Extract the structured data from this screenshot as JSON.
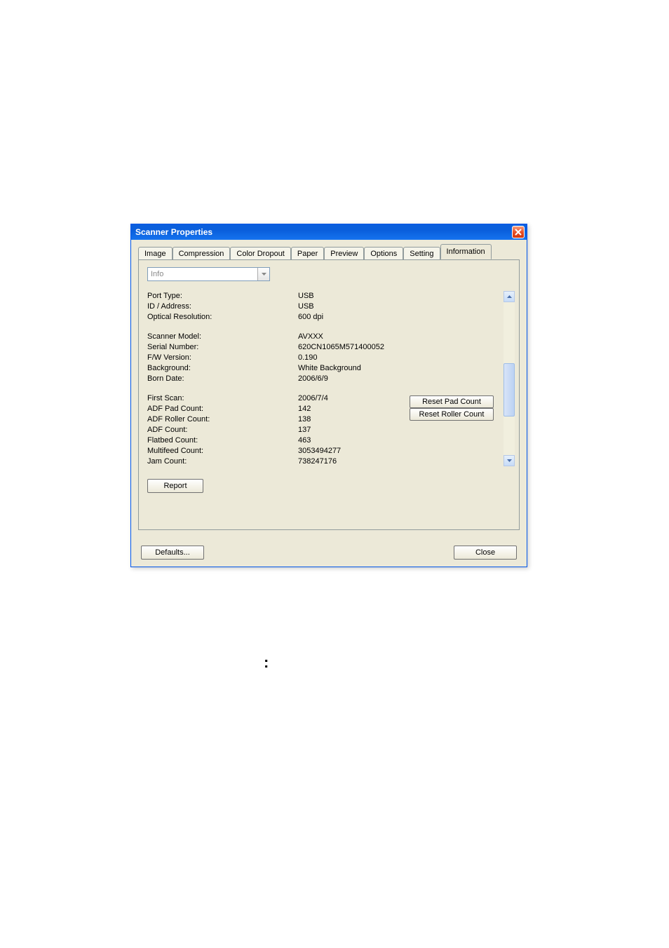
{
  "window": {
    "title": "Scanner Properties"
  },
  "tabs": {
    "image": "Image",
    "compression": "Compression",
    "color_dropout": "Color Dropout",
    "paper": "Paper",
    "preview": "Preview",
    "options": "Options",
    "setting": "Setting",
    "information": "Information"
  },
  "info_dropdown": {
    "value": "Info"
  },
  "fields": {
    "port_type": {
      "label": "Port Type:",
      "value": "USB"
    },
    "id_address": {
      "label": "ID / Address:",
      "value": "USB"
    },
    "optical_res": {
      "label": "Optical Resolution:",
      "value": "600 dpi"
    },
    "scanner_model": {
      "label": "Scanner Model:",
      "value": "AVXXX"
    },
    "serial_number": {
      "label": "Serial Number:",
      "value": "620CN1065M571400052"
    },
    "fw_version": {
      "label": "F/W Version:",
      "value": "0.190"
    },
    "background": {
      "label": "Background:",
      "value": "White Background"
    },
    "born_date": {
      "label": "Born Date:",
      "value": "2006/6/9"
    },
    "first_scan": {
      "label": "First Scan:",
      "value": "2006/7/4"
    },
    "adf_pad_count": {
      "label": "ADF Pad Count:",
      "value": "142"
    },
    "adf_roller_count": {
      "label": "ADF Roller Count:",
      "value": "138"
    },
    "adf_count": {
      "label": "ADF Count:",
      "value": "137"
    },
    "flatbed_count": {
      "label": "Flatbed Count:",
      "value": "463"
    },
    "multifeed_count": {
      "label": "Multifeed Count:",
      "value": "3053494277"
    },
    "jam_count": {
      "label": "Jam Count:",
      "value": "738247176"
    }
  },
  "buttons": {
    "reset_pad": "Reset Pad Count",
    "reset_roller": "Reset Roller Count",
    "report": "Report",
    "defaults": "Defaults...",
    "close": "Close"
  },
  "page_decor": {
    "colon": ":"
  }
}
